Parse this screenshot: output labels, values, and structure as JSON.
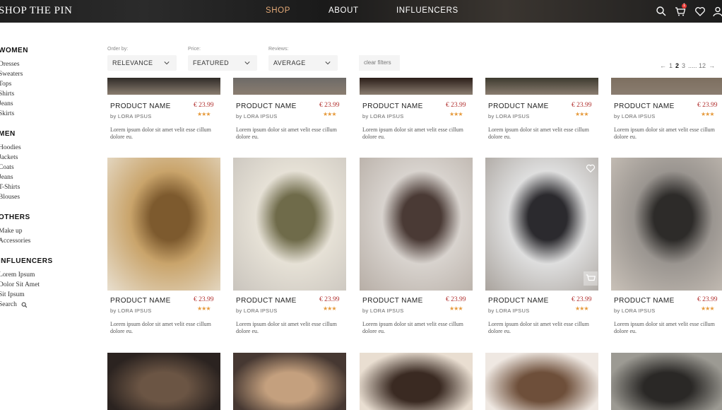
{
  "header": {
    "brand": "SHOP THE PIN",
    "nav": [
      "SHOP",
      "ABOUT",
      "INFLUENCERS"
    ],
    "active_nav": "SHOP",
    "cart_count": "1",
    "icons": [
      "search-icon",
      "cart-icon",
      "heart-icon",
      "user-icon"
    ]
  },
  "sidebar": {
    "groups": [
      {
        "title": "WOMEN",
        "items": [
          "Dresses",
          "Sweaters",
          "Tops",
          "Shirts",
          "Jeans",
          "Skirts"
        ]
      },
      {
        "title": "MEN",
        "items": [
          "Hoodies",
          "Jackets",
          "Coats",
          "Jeans",
          "T-Shirts",
          "Blouses"
        ]
      },
      {
        "title": "OTHERS",
        "items": [
          "Make up",
          "Accessories"
        ]
      },
      {
        "title": "INFLUENCERS",
        "items": [
          "Lorem Ipsum",
          "Dolor Sit Amet",
          "Sit Ipsum"
        ]
      }
    ],
    "search_label": "Search"
  },
  "filters": {
    "order_label": "Order by:",
    "order_value": "RELEVANCE",
    "price_label": "Price:",
    "price_value": "FEATURED",
    "reviews_label": "Reviews:",
    "reviews_value": "AVERAGE",
    "clear": "clear filters"
  },
  "pagination": {
    "prev": "←",
    "pages": [
      "1",
      "2",
      "3",
      "..... 12"
    ],
    "current": "2",
    "next": "→"
  },
  "product": {
    "name": "PRODUCT NAME",
    "price": "€ 23.99",
    "by": "by LORA IPSUS",
    "rating": 2.5,
    "stars": "★★★",
    "desc": "Lorem ipsum dolor sit amet velit esse cillum dolore eu."
  },
  "colors": {
    "accent": "#e3a977",
    "price": "#b1302f",
    "star": "#e69a3c"
  }
}
